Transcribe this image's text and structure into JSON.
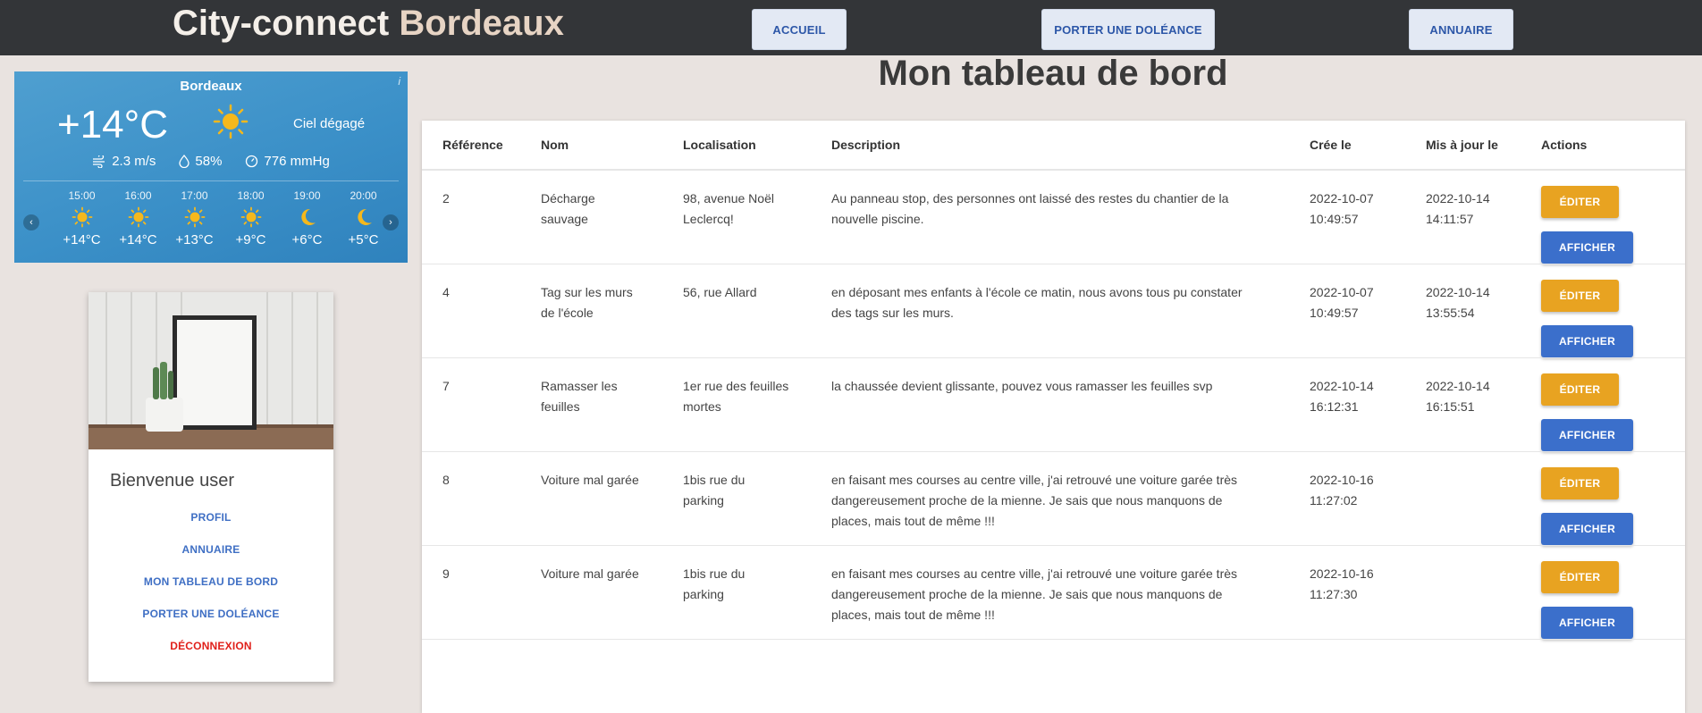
{
  "header": {
    "brand_part1": "City-connect ",
    "brand_part2": "Bordeaux",
    "nav": [
      {
        "label": "ACCUEIL"
      },
      {
        "label": "PORTER UNE DOLÉANCE"
      },
      {
        "label": "ANNUAIRE"
      }
    ]
  },
  "weather": {
    "city": "Bordeaux",
    "info": "i",
    "temperature": "+14°C",
    "condition": "Ciel dégagé",
    "wind": "2.3 m/s",
    "humidity": "58%",
    "pressure": "776 mmHg",
    "hours": [
      {
        "time": "15:00",
        "icon": "sun-icon",
        "temp": "+14°C"
      },
      {
        "time": "16:00",
        "icon": "sun-icon",
        "temp": "+14°C"
      },
      {
        "time": "17:00",
        "icon": "sun-icon",
        "temp": "+13°C"
      },
      {
        "time": "18:00",
        "icon": "sun-icon",
        "temp": "+9°C"
      },
      {
        "time": "19:00",
        "icon": "moon-icon",
        "temp": "+6°C"
      },
      {
        "time": "20:00",
        "icon": "moon-icon",
        "temp": "+5°C"
      }
    ],
    "prev": "‹",
    "next": "›",
    "colors": {
      "sun": "#f5b81c",
      "background": "#3b90c8"
    }
  },
  "profile": {
    "welcome": "Bienvenue user",
    "links": [
      "PROFIL",
      "ANNUAIRE",
      "MON TABLEAU DE BORD",
      "PORTER UNE DOLÉANCE"
    ],
    "logout": "DÉCONNEXION"
  },
  "main": {
    "title": "Mon tableau de bord",
    "columns": [
      "Référence",
      "Nom",
      "Localisation",
      "Description",
      "Crée le",
      "Mis à jour le",
      "Actions"
    ],
    "edit_label": "ÉDITER",
    "show_label": "AFFICHER",
    "rows": [
      {
        "ref": "2",
        "name": [
          "Décharge",
          "sauvage"
        ],
        "location": [
          "98, avenue Noël",
          "Leclercq!"
        ],
        "description": [
          "Au panneau stop, des personnes ont laissé des restes du chantier de la",
          "nouvelle piscine."
        ],
        "created": [
          "2022-10-07",
          "10:49:57"
        ],
        "updated": [
          "2022-10-14",
          "14:11:57"
        ]
      },
      {
        "ref": "4",
        "name": [
          "Tag sur les murs",
          "de l'école"
        ],
        "location": [
          "56, rue Allard"
        ],
        "description": [
          "en déposant mes enfants à l'école ce matin, nous avons tous pu constater",
          "des tags sur les murs."
        ],
        "created": [
          "2022-10-07",
          "10:49:57"
        ],
        "updated": [
          "2022-10-14",
          "13:55:54"
        ]
      },
      {
        "ref": "7",
        "name": [
          "Ramasser les",
          "feuilles"
        ],
        "location": [
          "1er rue des feuilles",
          "mortes"
        ],
        "description": [
          "la chaussée devient glissante, pouvez vous ramasser les feuilles svp"
        ],
        "created": [
          "2022-10-14",
          "16:12:31"
        ],
        "updated": [
          "2022-10-14",
          "16:15:51"
        ]
      },
      {
        "ref": "8",
        "name": [
          "Voiture mal garée"
        ],
        "location": [
          "1bis rue du",
          "parking"
        ],
        "description": [
          "en faisant mes courses au centre ville, j'ai retrouvé une voiture garée très",
          "dangereusement proche de la mienne. Je sais que nous manquons de",
          "places, mais tout de même !!!"
        ],
        "created": [
          "2022-10-16",
          "11:27:02"
        ],
        "updated": []
      },
      {
        "ref": "9",
        "name": [
          "Voiture mal garée"
        ],
        "location": [
          "1bis rue du",
          "parking"
        ],
        "description": [
          "en faisant mes courses au centre ville, j'ai retrouvé une voiture garée très",
          "dangereusement proche de la mienne. Je sais que nous manquons de",
          "places, mais tout de même !!!"
        ],
        "created": [
          "2022-10-16",
          "11:27:30"
        ],
        "updated": []
      }
    ]
  }
}
